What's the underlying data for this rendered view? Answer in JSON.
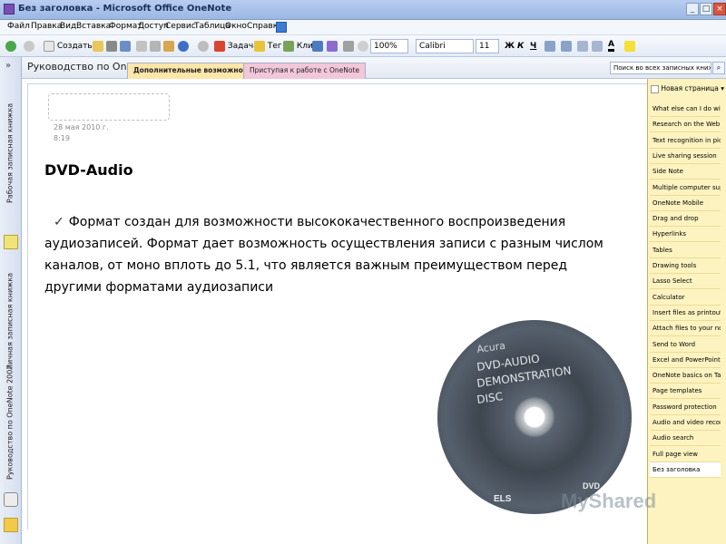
{
  "window": {
    "title": "Без заголовка - Microsoft Office OneNote"
  },
  "menu": [
    "Файл",
    "Правка",
    "Вид",
    "Вставка",
    "Формат",
    "Доступ",
    "Сервис",
    "Таблица",
    "Окно",
    "Справка"
  ],
  "toolbar": {
    "create_label": "Создать",
    "task_label": "Задача",
    "tag_label": "Тег",
    "clip_label": "Клип",
    "zoom": "100%",
    "font": "Calibri",
    "font_size": "11",
    "bold": "Ж",
    "italic": "К",
    "underline": "Ч",
    "font_color_label": "A"
  },
  "notebook_strip": [
    "Рабочая записная книжка",
    "Личная записная книжка",
    "Руководство по OneNote 2007"
  ],
  "notebook_title": "Руководство по On...",
  "section_tabs": [
    {
      "label": "Дополнительные возможности",
      "color": "#fde6a9"
    },
    {
      "label": "Приступая к работе с OneNote",
      "color": "#f2c7d9"
    }
  ],
  "search_placeholder": "Поиск во всех записных книжках",
  "note": {
    "date": "28 мая 2010 г.",
    "time": "8:19",
    "heading": "DVD-Audio",
    "body": "Формат создан для возможности высококачественного воспроизведения аудиозаписей. Формат дает возможность осуществления записи с разным числом каналов, от моно вплоть до 5.1, что является важным преимуществом перед другими форматами аудиозаписи"
  },
  "disc": {
    "title_lines": [
      "Acura",
      "DVD-AUDIO",
      "DEMONSTRATION",
      "DISC"
    ],
    "logos": [
      "ELS",
      "DVD"
    ]
  },
  "pages": {
    "new_page": "Новая страница",
    "items": [
      "What else can I do with",
      "Research on the Web",
      "Text recognition in pictur",
      "Live sharing session",
      "Side Note",
      "Multiple computer suppor",
      "OneNote Mobile",
      "Drag and drop",
      "Hyperlinks",
      "Tables",
      "Drawing tools",
      "Lasso Select",
      "Calculator",
      "Insert files as printouts",
      "Attach files to your note",
      "Send to Word",
      "Excel and PowerPoint int",
      "OneNote basics on Table",
      "Page templates",
      "Password protection",
      "Audio and video recordin",
      "Audio search",
      "Full page view",
      "Без заголовка"
    ]
  },
  "watermark": "MyShared"
}
